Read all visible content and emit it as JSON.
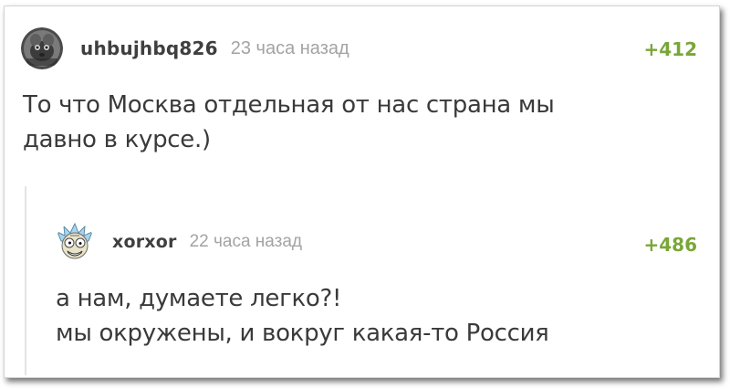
{
  "comment": {
    "username": "uhbujhbq826",
    "timestamp": "23 часа назад",
    "rating": "+412",
    "lines": [
      "То что Москва отдельная от нас страна мы",
      "давно в курсе.)"
    ],
    "avatar_icon": "user-avatar-icon"
  },
  "reply": {
    "username": "xorxor",
    "timestamp": "22 часа назад",
    "rating": "+486",
    "lines": [
      "а нам, думаете легко?!",
      "мы окружены, и вокруг какая-то Россия"
    ],
    "avatar_icon": "cartoon-avatar-icon"
  },
  "colors": {
    "rating_green": "#79a638",
    "text": "#3a3a3a",
    "muted": "#a3a3a3",
    "username": "#3f3f3f"
  }
}
